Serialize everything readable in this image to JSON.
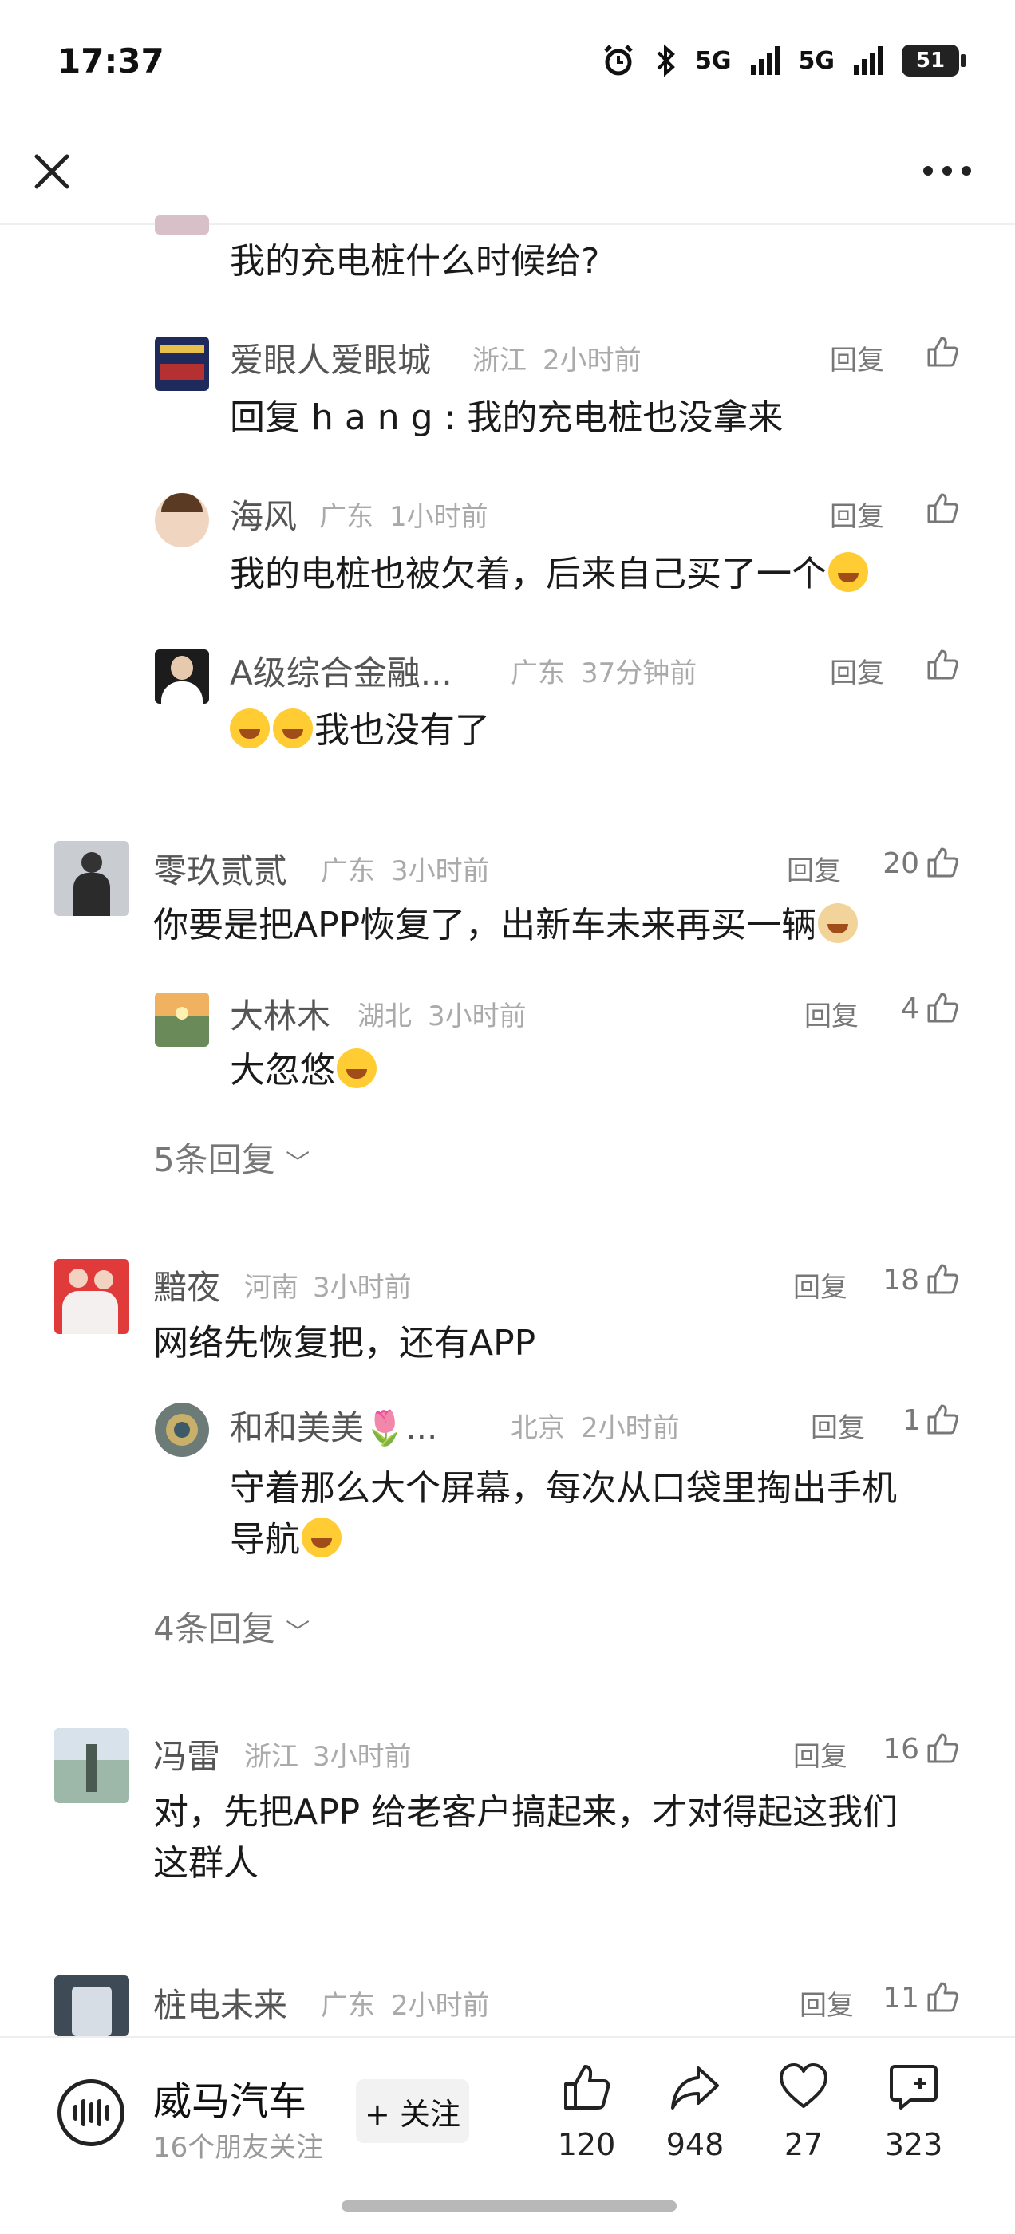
{
  "status_bar": {
    "time": "17:37",
    "network1": "5G",
    "network2": "5G",
    "battery": "51"
  },
  "comments": [
    {
      "text": "我的充电桩什么时候给?"
    },
    {
      "name": "爱眼人爱眼城",
      "location": "浙江",
      "time": "2小时前",
      "reply": "回复",
      "likes": "",
      "text": "回复 h a n g : 我的充电桩也没拿来"
    },
    {
      "name": "海风",
      "location": "广东",
      "time": "1小时前",
      "reply": "回复",
      "likes": "",
      "text": "我的电桩也被欠着，后来自己买了一个"
    },
    {
      "name": "A级综合金融...",
      "location": "广东",
      "time": "37分钟前",
      "reply": "回复",
      "likes": "",
      "text": "我也没有了"
    },
    {
      "name": "零玖贰贰",
      "location": "广东",
      "time": "3小时前",
      "reply": "回复",
      "likes": "20",
      "text": "你要是把APP恢复了，出新车未来再买一辆"
    },
    {
      "name": "大林木",
      "location": "湖北",
      "time": "3小时前",
      "reply": "回复",
      "likes": "4",
      "text": "大忽悠"
    },
    {
      "name": "黯夜",
      "location": "河南",
      "time": "3小时前",
      "reply": "回复",
      "likes": "18",
      "text": "网络先恢复把，还有APP"
    },
    {
      "name": "和和美美🌷...",
      "location": "北京",
      "time": "2小时前",
      "reply": "回复",
      "likes": "1",
      "text_line1": "守着那么大个屏幕，每次从口袋里掏出手机",
      "text_line2": "导航"
    },
    {
      "name": "冯雷",
      "location": "浙江",
      "time": "3小时前",
      "reply": "回复",
      "likes": "16",
      "text_line1": "对，先把APP 给老客户搞起来，才对得起这我们",
      "text_line2": "这群人"
    },
    {
      "name": "桩电未来",
      "location": "广东",
      "time": "2小时前",
      "reply": "回复",
      "likes": "11"
    }
  ],
  "more_replies": [
    "5条回复",
    "4条回复"
  ],
  "bottom_bar": {
    "account_name": "威马汽车",
    "friends_following": "16个朋友关注",
    "follow_label": "+ 关注",
    "likes": "120",
    "shares": "948",
    "favorites": "27",
    "comments": "323"
  }
}
